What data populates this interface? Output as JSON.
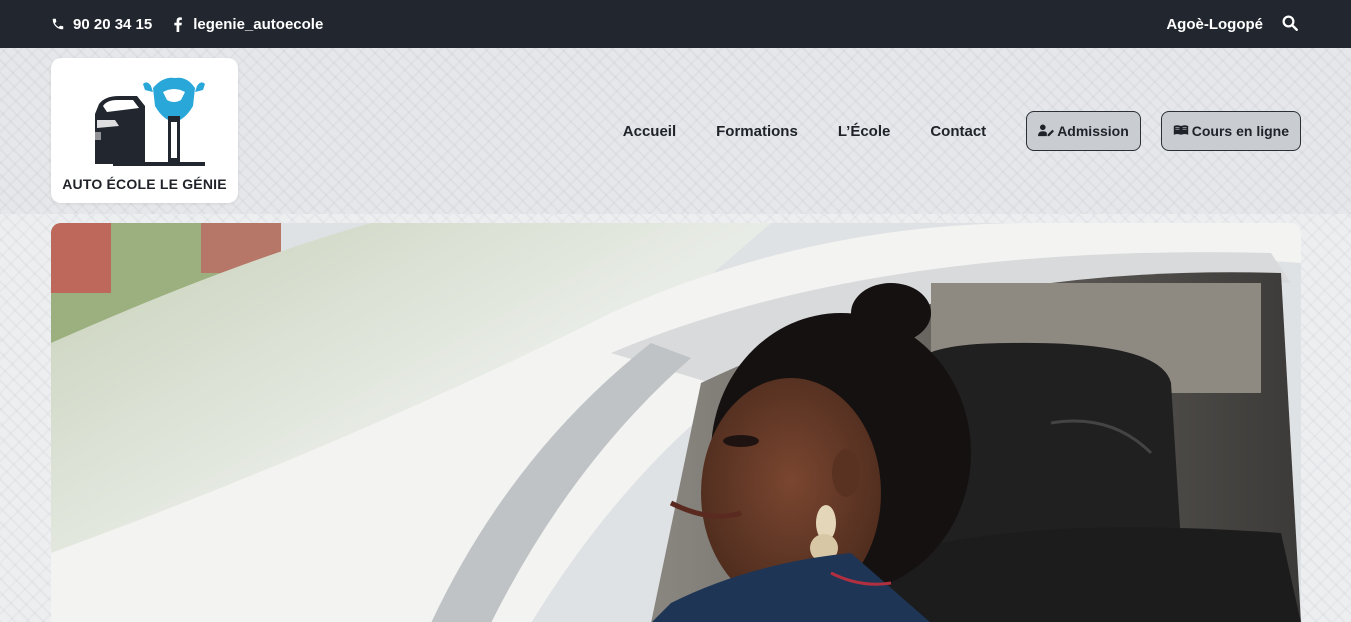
{
  "topbar": {
    "phone": "90 20 34 15",
    "social_handle": "legenie_autoecole",
    "location": "Agoè-Logopé",
    "icons": {
      "phone": "phone-icon",
      "facebook": "facebook-icon",
      "search": "search-icon"
    }
  },
  "logo": {
    "brand": "AUTO ÉCOLE LE GÉNIE",
    "colors": {
      "car": "#22262f",
      "moto": "#2aa7d9"
    }
  },
  "nav": {
    "links": [
      "Accueil",
      "Formations",
      "L’École",
      "Contact"
    ],
    "buttons": [
      {
        "label": "Admission",
        "icon": "user-edit-icon"
      },
      {
        "label": "Cours en ligne",
        "icon": "book-open-icon"
      }
    ]
  },
  "colors": {
    "topbar": "#22262f",
    "pill_bg": "#c9ccd1",
    "text": "#1f2329"
  }
}
